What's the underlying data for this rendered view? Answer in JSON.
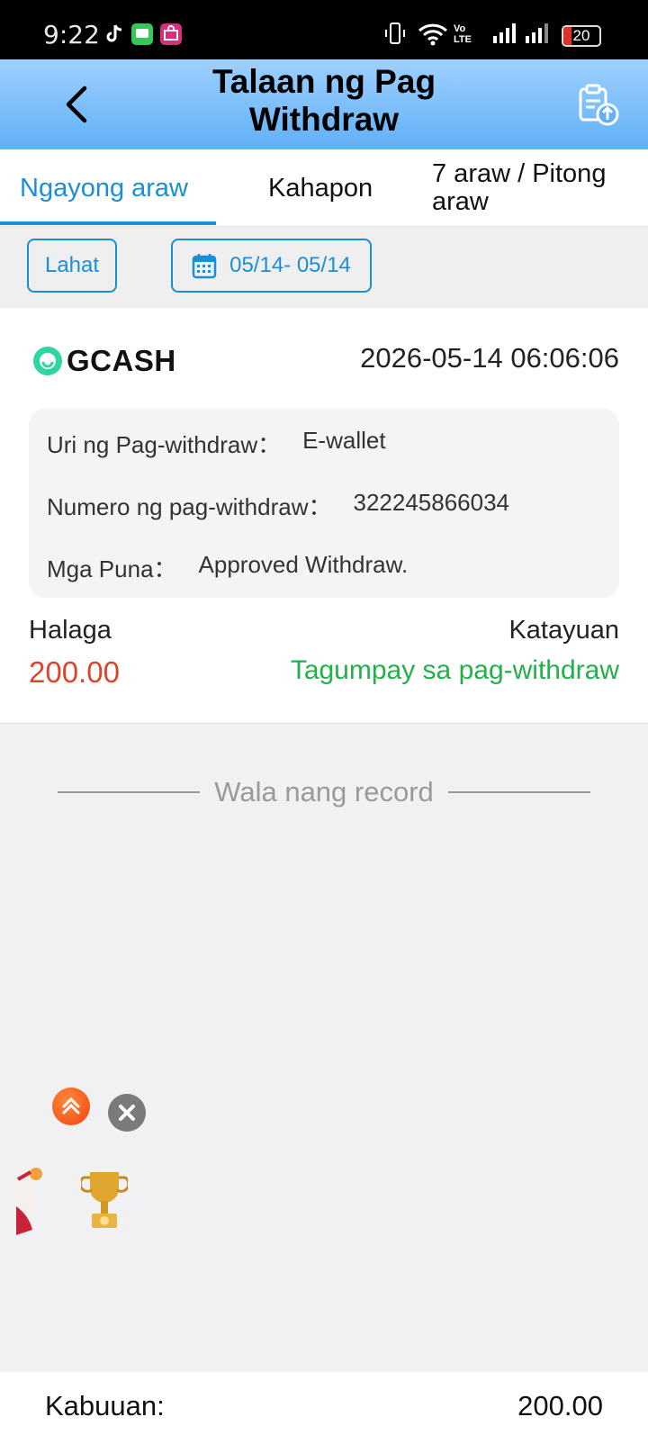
{
  "status_bar": {
    "time": "9:22",
    "battery": "20",
    "network_label": "Vo LTE"
  },
  "header": {
    "title": "Talaan ng Pag Withdraw",
    "back_icon": "chevron-left-icon",
    "export_icon": "clipboard-upload-icon"
  },
  "tabs": [
    {
      "label": "Ngayong araw",
      "active": true
    },
    {
      "label": "Kahapon",
      "active": false
    },
    {
      "label": "7 araw / Pitong araw",
      "active": false
    }
  ],
  "filters": {
    "all_label": "Lahat",
    "date_range": "05/14- 05/14",
    "date_icon": "calendar-icon"
  },
  "record": {
    "channel": "GCASH",
    "datetime": "2026-05-14 06:06:06",
    "details": [
      {
        "key": "Uri ng Pag-withdraw：",
        "value": "E-wallet"
      },
      {
        "key": "Numero ng pag-withdraw：",
        "value": "322245866034"
      },
      {
        "key": "Mga Puna：",
        "value": "Approved Withdraw."
      }
    ],
    "amount_label": "Halaga",
    "amount": "200.00",
    "status_label": "Katayuan",
    "status": "Tagumpay sa pag-withdraw",
    "colors": {
      "amount": "#d9472b",
      "status": "#22b04b"
    }
  },
  "no_more_text": "Wala nang record",
  "footer": {
    "total_label": "Kabuuan:",
    "total_value": "200.00"
  },
  "accent_color": "#1b8fd6"
}
